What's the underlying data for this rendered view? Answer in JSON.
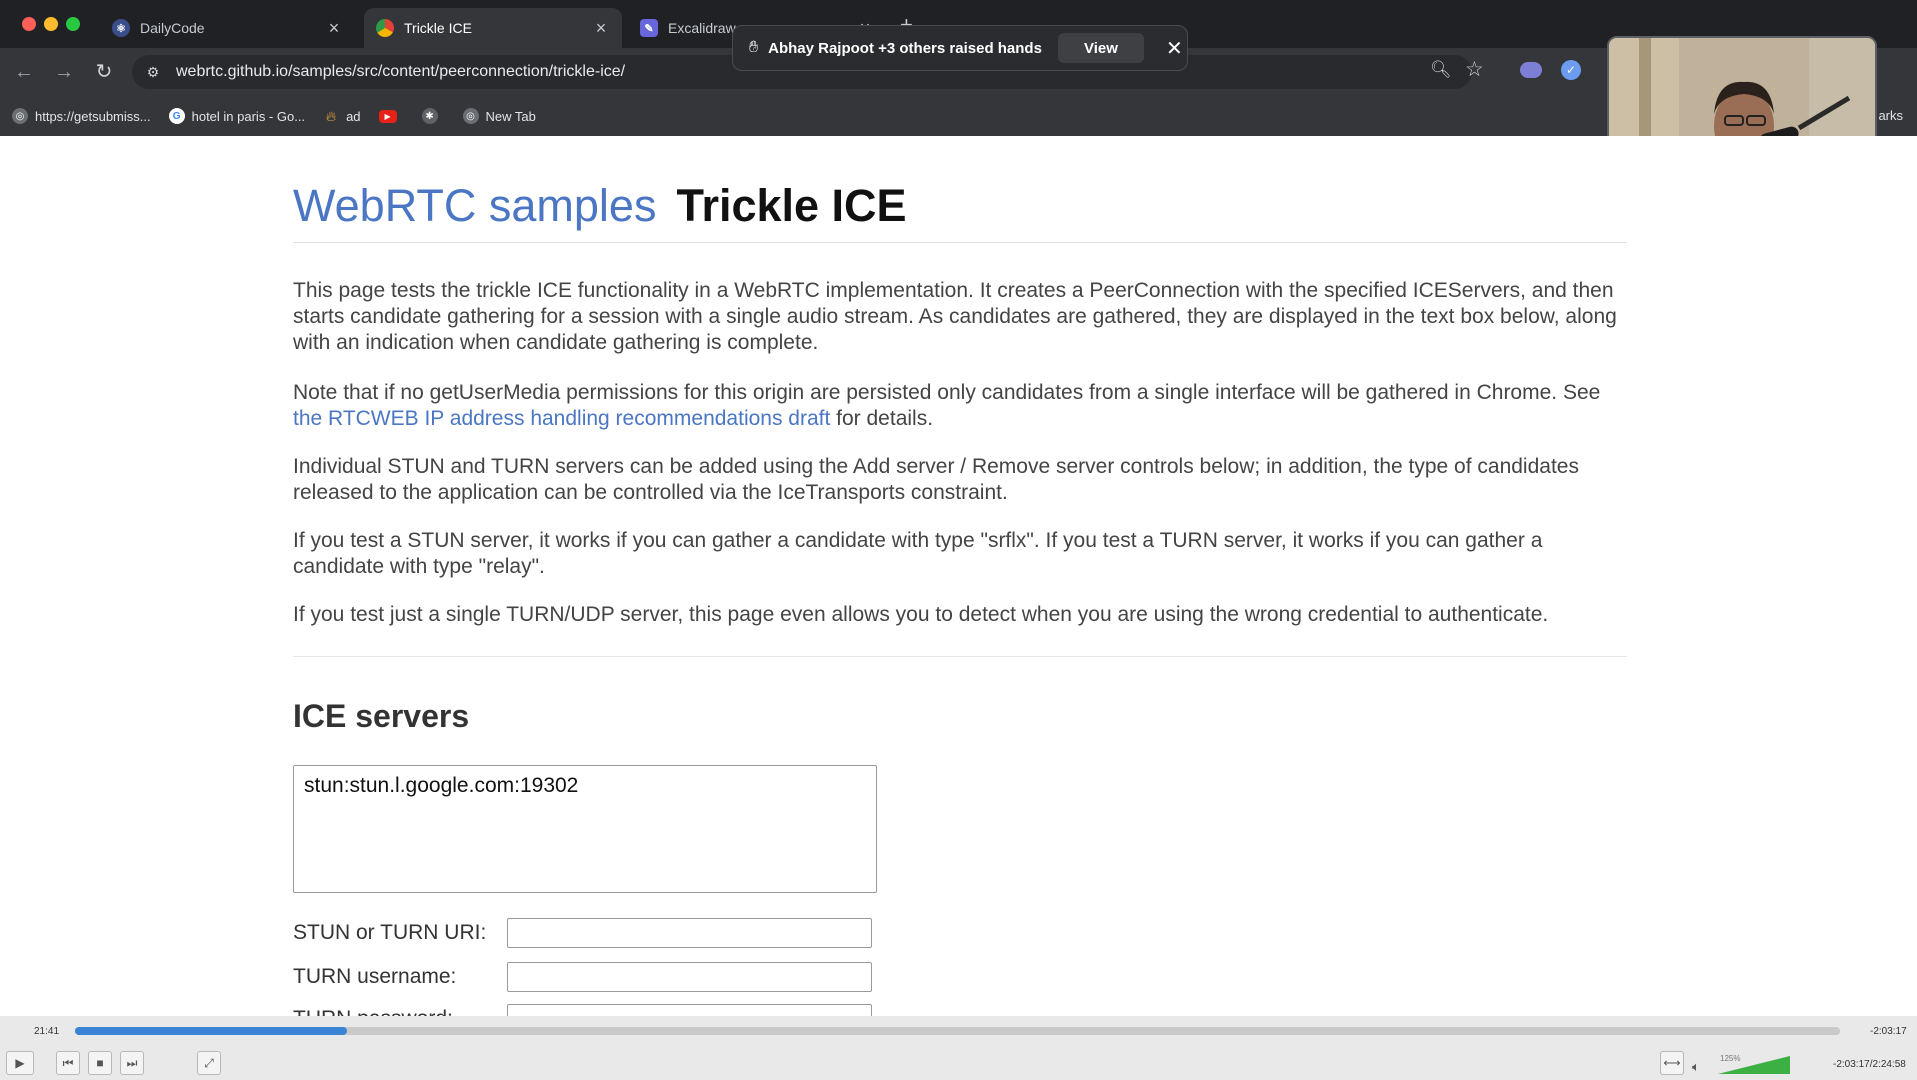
{
  "browser": {
    "tabs": [
      {
        "title": "DailyCode",
        "active": false
      },
      {
        "title": "Trickle ICE",
        "active": true
      },
      {
        "title": "Excalidraw",
        "active": false
      }
    ],
    "url": "webrtc.github.io/samples/src/content/peerconnection/trickle-ice/",
    "bookmarks": [
      {
        "label": "https://getsubmiss..."
      },
      {
        "label": "hotel in paris - Go..."
      },
      {
        "label": "ad"
      },
      {
        "label": ""
      },
      {
        "label": ""
      },
      {
        "label": "New Tab"
      }
    ],
    "bookmarks_overflow": "arks"
  },
  "notification": {
    "text": "Abhay Rajpoot +3 others raised hands",
    "view_label": "View"
  },
  "page": {
    "heading_link": "WebRTC samples",
    "heading_title": "Trickle ICE",
    "p1": "This page tests the trickle ICE functionality in a WebRTC implementation. It creates a PeerConnection with the specified ICEServers, and then starts candidate gathering for a session with a single audio stream. As candidates are gathered, they are displayed in the text box below, along with an indication when candidate gathering is complete.",
    "p2_before": "Note that if no getUserMedia permissions for this origin are persisted only candidates from a single interface will be gathered in Chrome. See ",
    "p2_link": "the RTCWEB IP address handling recommendations draft",
    "p2_after": " for details.",
    "p3": "Individual STUN and TURN servers can be added using the Add server / Remove server controls below; in addition, the type of candidates released to the application can be controlled via the IceTransports constraint.",
    "p4": "If you test a STUN server, it works if you can gather a candidate with type \"srflx\". If you test a TURN server, it works if you can gather a candidate with type \"relay\".",
    "p5": "If you test just a single TURN/UDP server, this page even allows you to detect when you are using the wrong credential to authenticate.",
    "ice_heading": "ICE servers",
    "server_entry": "stun:stun.l.google.com:19302",
    "uri_label": "STUN or TURN URI:",
    "username_label": "TURN username:",
    "password_label": "TURN password:"
  },
  "player": {
    "elapsed": "21:41",
    "remaining": "-2:03:17",
    "total": "-2:03:17/2:24:58",
    "progress": 0.154,
    "volume_label": "125%",
    "volume": 1.0
  },
  "colors": {
    "chrome_bg": "#1f2124",
    "toolbar_bg": "#35363a",
    "link_blue": "#4a76c4",
    "progress_blue": "#3a84d6"
  }
}
